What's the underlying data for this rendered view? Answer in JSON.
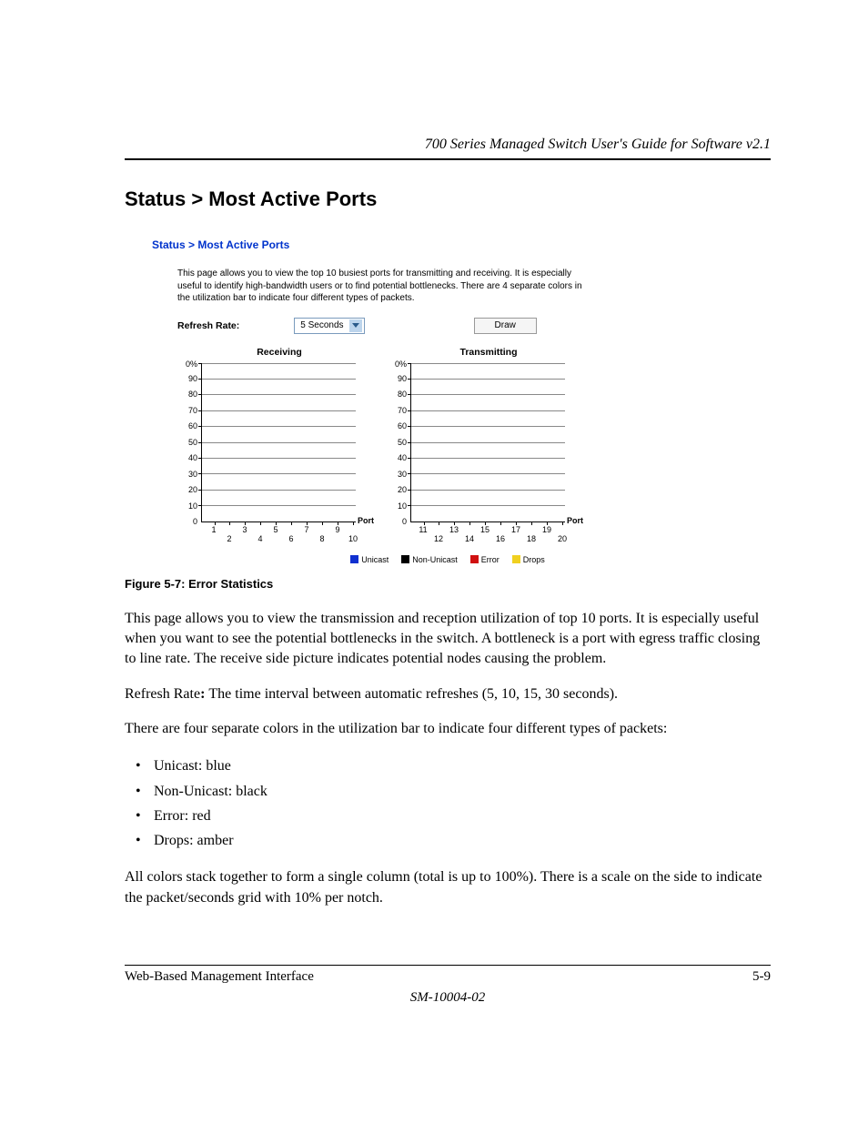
{
  "header": {
    "guide_title": "700 Series Managed Switch User's Guide for Software v2.1"
  },
  "section": {
    "title": "Status > Most Active Ports"
  },
  "screenshot": {
    "breadcrumb": "Status > Most Active Ports",
    "description": "This page allows you to view the top 10 busiest ports for transmitting and receiving. It is especially useful to identify high-bandwidth users or to find potential bottlenecks. There are 4 separate colors in the utilization bar to indicate four different types of packets.",
    "refresh_label": "Refresh Rate:",
    "refresh_value": "5 Seconds",
    "draw_button": "Draw",
    "legend": {
      "unicast": "Unicast",
      "non_unicast": "Non-Unicast",
      "error": "Error",
      "drops": "Drops"
    },
    "colors": {
      "unicast": "#1030d0",
      "non_unicast": "#000000",
      "error": "#d01010",
      "drops": "#f0d020"
    }
  },
  "chart_data": [
    {
      "type": "bar",
      "title": "Receiving",
      "categories": [
        "1",
        "2",
        "3",
        "4",
        "5",
        "6",
        "7",
        "8",
        "9",
        "10"
      ],
      "values": [
        0,
        0,
        0,
        0,
        0,
        0,
        0,
        0,
        0,
        0
      ],
      "ylabel": "",
      "xlabel": "Port",
      "ylim": [
        0,
        100
      ],
      "yticks": [
        "0%",
        "90",
        "80",
        "70",
        "60",
        "50",
        "40",
        "30",
        "20",
        "10",
        "0"
      ]
    },
    {
      "type": "bar",
      "title": "Transmitting",
      "categories": [
        "11",
        "12",
        "13",
        "14",
        "15",
        "16",
        "17",
        "18",
        "19",
        "20"
      ],
      "values": [
        0,
        0,
        0,
        0,
        0,
        0,
        0,
        0,
        0,
        0
      ],
      "ylabel": "",
      "xlabel": "Port",
      "ylim": [
        0,
        100
      ],
      "yticks": [
        "0%",
        "90",
        "80",
        "70",
        "60",
        "50",
        "40",
        "30",
        "20",
        "10",
        "0"
      ]
    }
  ],
  "figure": {
    "caption": "Figure 5-7:  Error Statistics"
  },
  "body": {
    "para1": "This page allows you to view the transmission and reception utilization of top 10 ports. It is especially useful when you want to see the potential bottlenecks in the switch. A bottleneck is a port with egress traffic closing to line rate. The receive side picture indicates potential nodes causing the problem.",
    "refresh_label": "Refresh Rate",
    "refresh_colon": ": ",
    "refresh_desc": "The time interval between automatic refreshes (5, 10, 15, 30 seconds).",
    "para3": "There are four separate colors in the utilization bar to indicate four different types of packets:",
    "bullets": {
      "b1": "Unicast: blue",
      "b2": "Non-Unicast: black",
      "b3": "Error: red",
      "b4": "Drops: amber"
    },
    "para4": "All colors stack together to form a single column (total is up to 100%). There is a scale on the side to indicate the packet/seconds grid with 10% per notch."
  },
  "footer": {
    "section_name": "Web-Based Management Interface",
    "page_number": "5-9",
    "doc_number": "SM-10004-02"
  }
}
